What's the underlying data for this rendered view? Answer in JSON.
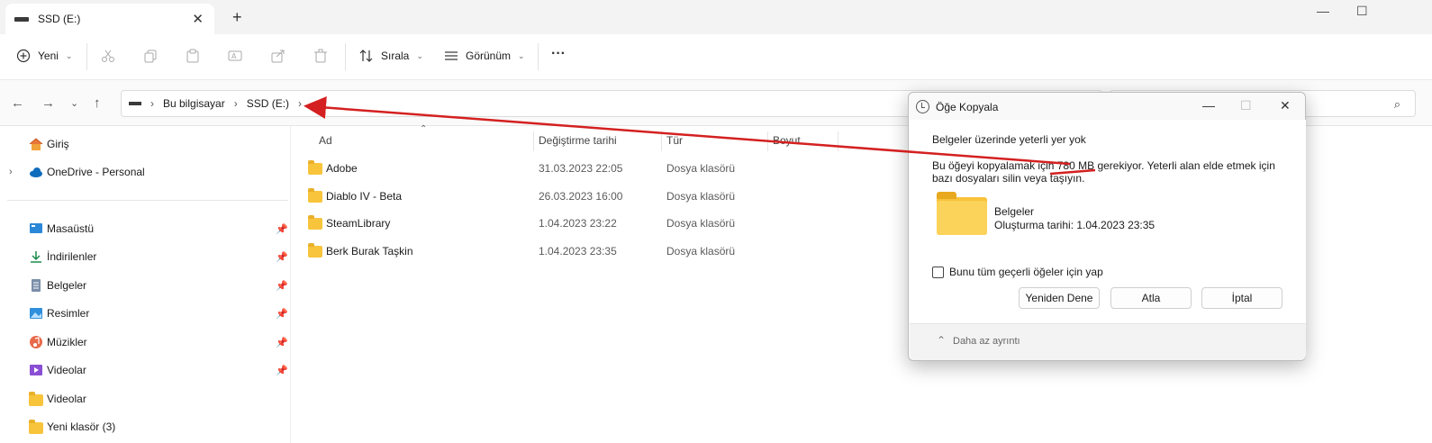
{
  "window": {
    "tab_title": "SSD (E:)",
    "close_glyph": "✕",
    "new_tab_glyph": "+",
    "minimize_glyph": "—",
    "maximize_glyph": "☐"
  },
  "toolbar": {
    "new_label": "Yeni",
    "sort_label": "Sırala",
    "view_label": "Görünüm",
    "more_glyph": "···",
    "icons": [
      "plus-circle-icon",
      "cut-icon",
      "copy-icon",
      "paste-icon",
      "rename-icon",
      "share-icon",
      "delete-icon",
      "sort-icon",
      "view-icon"
    ]
  },
  "address": {
    "crumbs": [
      "Bu bilgisayar",
      "SSD (E:)"
    ],
    "chevron": "›"
  },
  "sidebar": {
    "items": [
      {
        "label": "Giriş",
        "icon": "home-icon"
      },
      {
        "label": "OneDrive - Personal",
        "icon": "cloud-icon"
      },
      {
        "label": "Masaüstü",
        "icon": "desktop-icon",
        "pinned": true
      },
      {
        "label": "İndirilenler",
        "icon": "download-icon",
        "pinned": true
      },
      {
        "label": "Belgeler",
        "icon": "documents-icon",
        "pinned": true
      },
      {
        "label": "Resimler",
        "icon": "pictures-icon",
        "pinned": true
      },
      {
        "label": "Müzikler",
        "icon": "music-icon",
        "pinned": true
      },
      {
        "label": "Videolar",
        "icon": "videos-icon",
        "pinned": true
      },
      {
        "label": "Videolar",
        "icon": "folder-icon"
      },
      {
        "label": "Yeni klasör (3)",
        "icon": "folder-icon"
      }
    ]
  },
  "filelist": {
    "columns": [
      "Ad",
      "Değiştirme tarihi",
      "Tür",
      "Boyut"
    ],
    "rows": [
      {
        "name": "Adobe",
        "date": "31.03.2023 22:05",
        "type": "Dosya klasörü"
      },
      {
        "name": "Diablo IV - Beta",
        "date": "26.03.2023 16:00",
        "type": "Dosya klasörü"
      },
      {
        "name": "SteamLibrary",
        "date": "1.04.2023 23:22",
        "type": "Dosya klasörü"
      },
      {
        "name": "Berk Burak Taşkin",
        "date": "1.04.2023 23:35",
        "type": "Dosya klasörü"
      }
    ]
  },
  "dialog": {
    "title": "Öğe Kopyala",
    "message_title": "Belgeler üzerinde yeterli yer yok",
    "message_pre": "Bu öğeyi kopyalamak için ",
    "message_size": "780 MB",
    "message_post": " gerekiyor. Yeterli alan elde etmek için bazı dosyaları silin veya taşıyın.",
    "folder_name": "Belgeler",
    "folder_created": "Oluşturma tarihi: 1.04.2023 23:35",
    "checkbox_label": "Bunu tüm geçerli öğeler için yap",
    "retry_label": "Yeniden Dene",
    "skip_label": "Atla",
    "cancel_label": "İptal",
    "less_details_label": "Daha az ayrıntı"
  },
  "annotation_color": "#d42020"
}
